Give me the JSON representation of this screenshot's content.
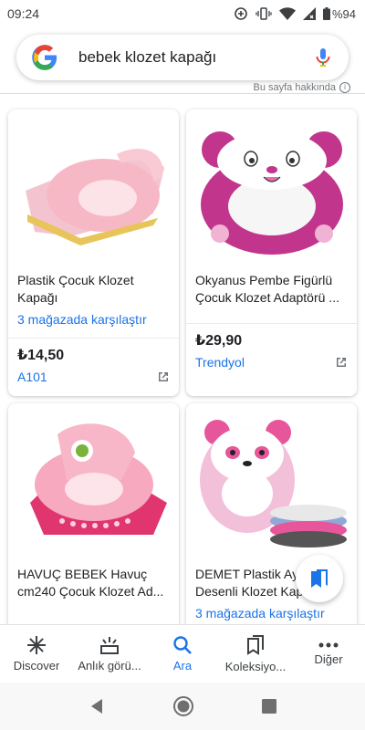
{
  "status_bar": {
    "time": "09:24",
    "battery_text": "%94",
    "icons": [
      "data-saver-icon",
      "vibrate-icon",
      "wifi-icon",
      "cellular-signal-icon",
      "battery-icon"
    ]
  },
  "search": {
    "query": "bebek klozet kapağı",
    "logo": "google-g-logo",
    "mic_icon": "microphone-icon"
  },
  "about_text": "Bu sayfa hakkında",
  "products": [
    {
      "title": "Plastik Çocuk Klozet Kapağı",
      "compare": "3 mağazada karşılaştır",
      "price": "₺14,50",
      "store": "A101"
    },
    {
      "title": "Okyanus Pembe Figürlü Çocuk Klozet Adaptörü ...",
      "compare": "",
      "price": "₺29,90",
      "store": "Trendyol"
    },
    {
      "title": "HAVUÇ BEBEK Havuç cm240 Çocuk Klozet Ad...",
      "compare": "",
      "price": "",
      "store": ""
    },
    {
      "title": "DEMET Plastik Ay... Desenli Klozet Kap...",
      "compare": "3 mağazada karşılaştır",
      "price": "",
      "store": ""
    }
  ],
  "bottom_nav": [
    {
      "label": "Discover",
      "icon": "asterisk-icon"
    },
    {
      "label": "Anlık görü...",
      "icon": "updates-icon"
    },
    {
      "label": "Ara",
      "icon": "search-icon"
    },
    {
      "label": "Koleksiyo...",
      "icon": "collections-icon"
    },
    {
      "label": "Diğer",
      "icon": "more-icon"
    }
  ],
  "colors": {
    "accent": "#1a73e8",
    "active_nav": "#1a73e8",
    "text_primary": "#202124"
  }
}
